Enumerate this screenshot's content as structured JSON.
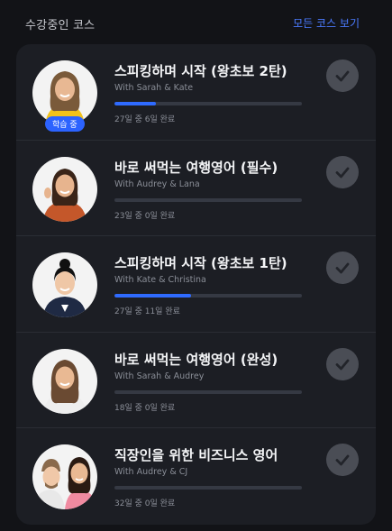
{
  "header": {
    "title": "수강중인 코스",
    "view_all": "모든 코스 보기"
  },
  "colors": {
    "accent": "#2f6bff",
    "background": "#121317",
    "card": "#1c1e24"
  },
  "courses": [
    {
      "title": "스피킹하며 시작 (왕초보 2탄)",
      "subtitle": "With Sarah & Kate",
      "progress_text": "27일 중 6일 완료",
      "progress": 0.22,
      "badge": "학습 중",
      "thumbnail": "instructor-portrait-blonde-yellow",
      "check_icon": "checkmark-icon"
    },
    {
      "title": "바로 써먹는 여행영어 (필수)",
      "subtitle": "With Audrey & Lana",
      "progress_text": "23일 중 0일 완료",
      "progress": 0,
      "thumbnail": "instructor-portrait-waving-orange",
      "check_icon": "checkmark-icon"
    },
    {
      "title": "스피킹하며 시작 (왕초보 1탄)",
      "subtitle": "With Kate & Christina",
      "progress_text": "27일 중 11일 완료",
      "progress": 0.41,
      "thumbnail": "instructor-portrait-bun-navy",
      "check_icon": "checkmark-icon"
    },
    {
      "title": "바로 써먹는 여행영어 (완성)",
      "subtitle": "With Sarah & Audrey",
      "progress_text": "18일 중 0일 완료",
      "progress": 0,
      "thumbnail": "instructor-portrait-longhair-white",
      "check_icon": "checkmark-icon"
    },
    {
      "title": "직장인을 위한 비즈니스 영어",
      "subtitle": "With Audrey & CJ",
      "progress_text": "32일 중 0일 완료",
      "progress": 0,
      "thumbnail": "instructor-portrait-duo",
      "check_icon": "checkmark-icon"
    }
  ]
}
